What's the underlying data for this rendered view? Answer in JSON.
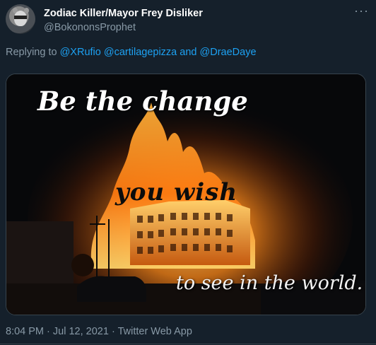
{
  "tweet": {
    "display_name": "Zodiac Killer/Mayor Frey Disliker",
    "handle": "@BokononsProphet",
    "more_icon": "more-horizontal-icon",
    "reply": {
      "prefix": "Replying to",
      "mention1": "@XRufio",
      "mention2": "@cartilagepizza",
      "joiner": "and",
      "mention3": "@DraeDaye"
    },
    "image": {
      "caption_line1": "Be the change",
      "caption_line2": "you wish",
      "caption_line3": "to see in the world."
    },
    "timestamp": "8:04 PM",
    "separator1": "·",
    "date": "Jul 12, 2021",
    "separator2": "·",
    "source": "Twitter Web App"
  },
  "colors": {
    "background": "#15202b",
    "secondary_text": "#8899a6",
    "link": "#1da1f2",
    "border": "#38444d"
  }
}
